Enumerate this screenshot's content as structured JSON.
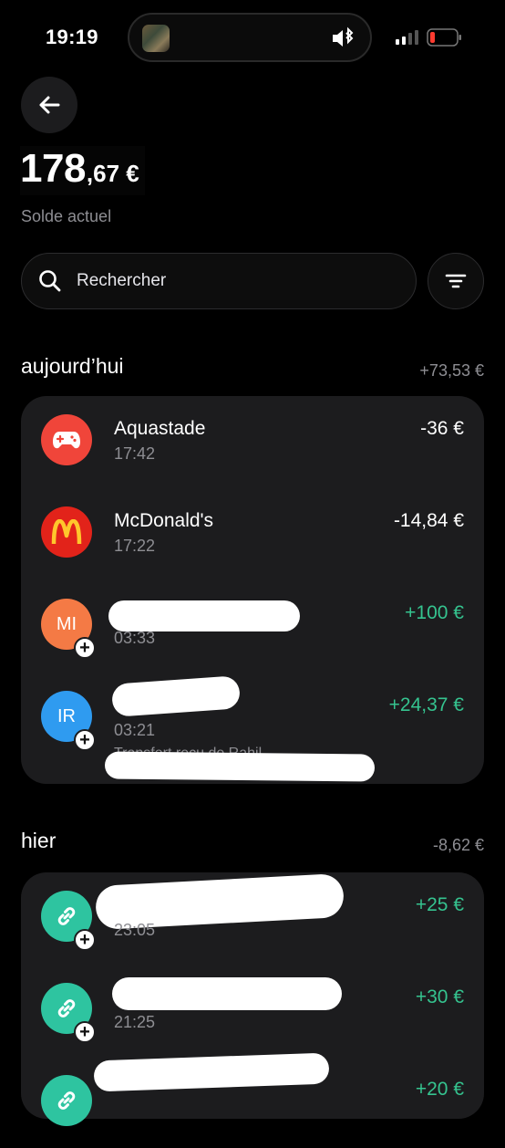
{
  "status_bar": {
    "time": "19:19"
  },
  "header": {
    "balance_integer": "178",
    "balance_decimal": ",67 €",
    "balance_label": "Solde actuel"
  },
  "search": {
    "placeholder": "Rechercher"
  },
  "sections": [
    {
      "title": "aujourd’hui",
      "total": "+73,53 €",
      "transactions": [
        {
          "name": "Aquastade",
          "time": "17:42",
          "amount": "-36 €",
          "icon": "gamepad-icon",
          "avatar_color": "#f0453a"
        },
        {
          "name": "McDonald's",
          "time": "17:22",
          "amount": "-14,84 €",
          "icon": "mcdonalds-logo-icon",
          "avatar_color": "#e2231a"
        },
        {
          "initials": "MI",
          "time": "03:33",
          "amount": "+100 €",
          "avatar_color": "#f47a45"
        },
        {
          "initials": "IR",
          "time": "03:21",
          "amount": "+24,37 €",
          "avatar_color": "#2f9bf0",
          "subtitle": "Transfert reçu de Rahil"
        }
      ]
    },
    {
      "title": "hier",
      "total": "-8,62 €",
      "transactions": [
        {
          "time": "23:05",
          "amount": "+25 €",
          "icon": "link-icon",
          "avatar_color": "#2ec4a0"
        },
        {
          "time": "21:25",
          "amount": "+30 €",
          "icon": "link-icon",
          "avatar_color": "#2ec4a0"
        },
        {
          "amount": "+20 €",
          "icon": "link-icon",
          "avatar_color": "#2ec4a0"
        }
      ]
    }
  ],
  "colors": {
    "positive": "#35c38f",
    "card": "#1c1c1e",
    "muted": "#8e8e93"
  }
}
